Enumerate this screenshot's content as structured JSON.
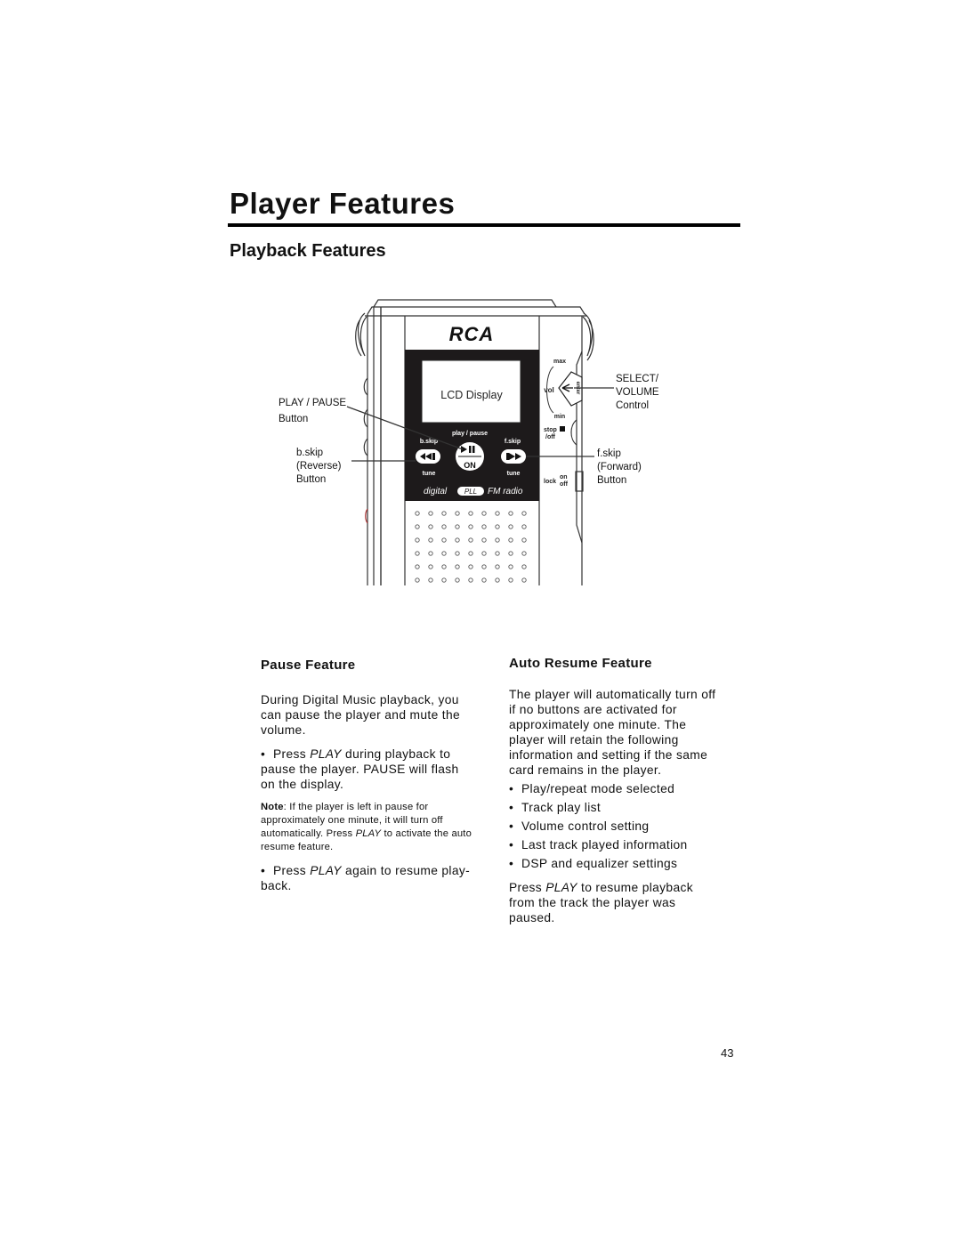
{
  "page": {
    "title": "Player Features",
    "subtitle": "Playback Features",
    "page_number": "43"
  },
  "figure": {
    "brand_logo": "RCA",
    "lcd_label": "LCD Display",
    "device_labels": {
      "play_pause_top": "play / pause",
      "on": "ON",
      "bskip": "b.skip",
      "fskip": "f.skip",
      "tune_left": "tune",
      "tune_right": "tune",
      "digital": "digital",
      "pll": "PLL",
      "fm_radio": "FM radio",
      "max": "max",
      "min": "min",
      "vol": "vol",
      "enter": "enter",
      "stop": "stop",
      "off": "/off",
      "lock": "lock",
      "lock_on": "on",
      "lock_off": "off"
    },
    "callouts": {
      "play_pause": [
        "PLAY / PAUSE",
        "Button"
      ],
      "bskip": [
        "b.skip",
        "(Reverse)",
        "Button"
      ],
      "select_volume": [
        "SELECT/",
        "VOLUME",
        "Control"
      ],
      "fskip": [
        "f.skip",
        "(Forward)",
        "Button"
      ]
    }
  },
  "pause_feature": {
    "heading": "Pause Feature",
    "intro": "During Digital Music playback, you can pause the player and mute the volume.",
    "step1_prefix": "Press ",
    "step1_em": "PLAY",
    "step1_suffix": " during playback to pause the player. PAUSE will flash on the display.",
    "note_label": "Note",
    "note_text_1": ": If the player is left in pause for approximately one minute, it will turn off automatically. Press ",
    "note_em": "PLAY",
    "note_text_2": " to activate the auto resume feature.",
    "step2_prefix": "Press ",
    "step2_em": "PLAY",
    "step2_suffix": " again to resume play-back."
  },
  "auto_resume": {
    "heading": "Auto Resume Feature",
    "intro": "The player will automatically turn off if no buttons are activated for approximately one minute. The player will retain the following information and setting if the same card remains in the player.",
    "items": [
      "Play/repeat mode selected",
      "Track play list",
      "Volume control setting",
      "Last track played information",
      "DSP and equalizer settings"
    ],
    "outro_prefix": "Press ",
    "outro_em": "PLAY",
    "outro_suffix": " to resume playback from the track the player was paused."
  }
}
